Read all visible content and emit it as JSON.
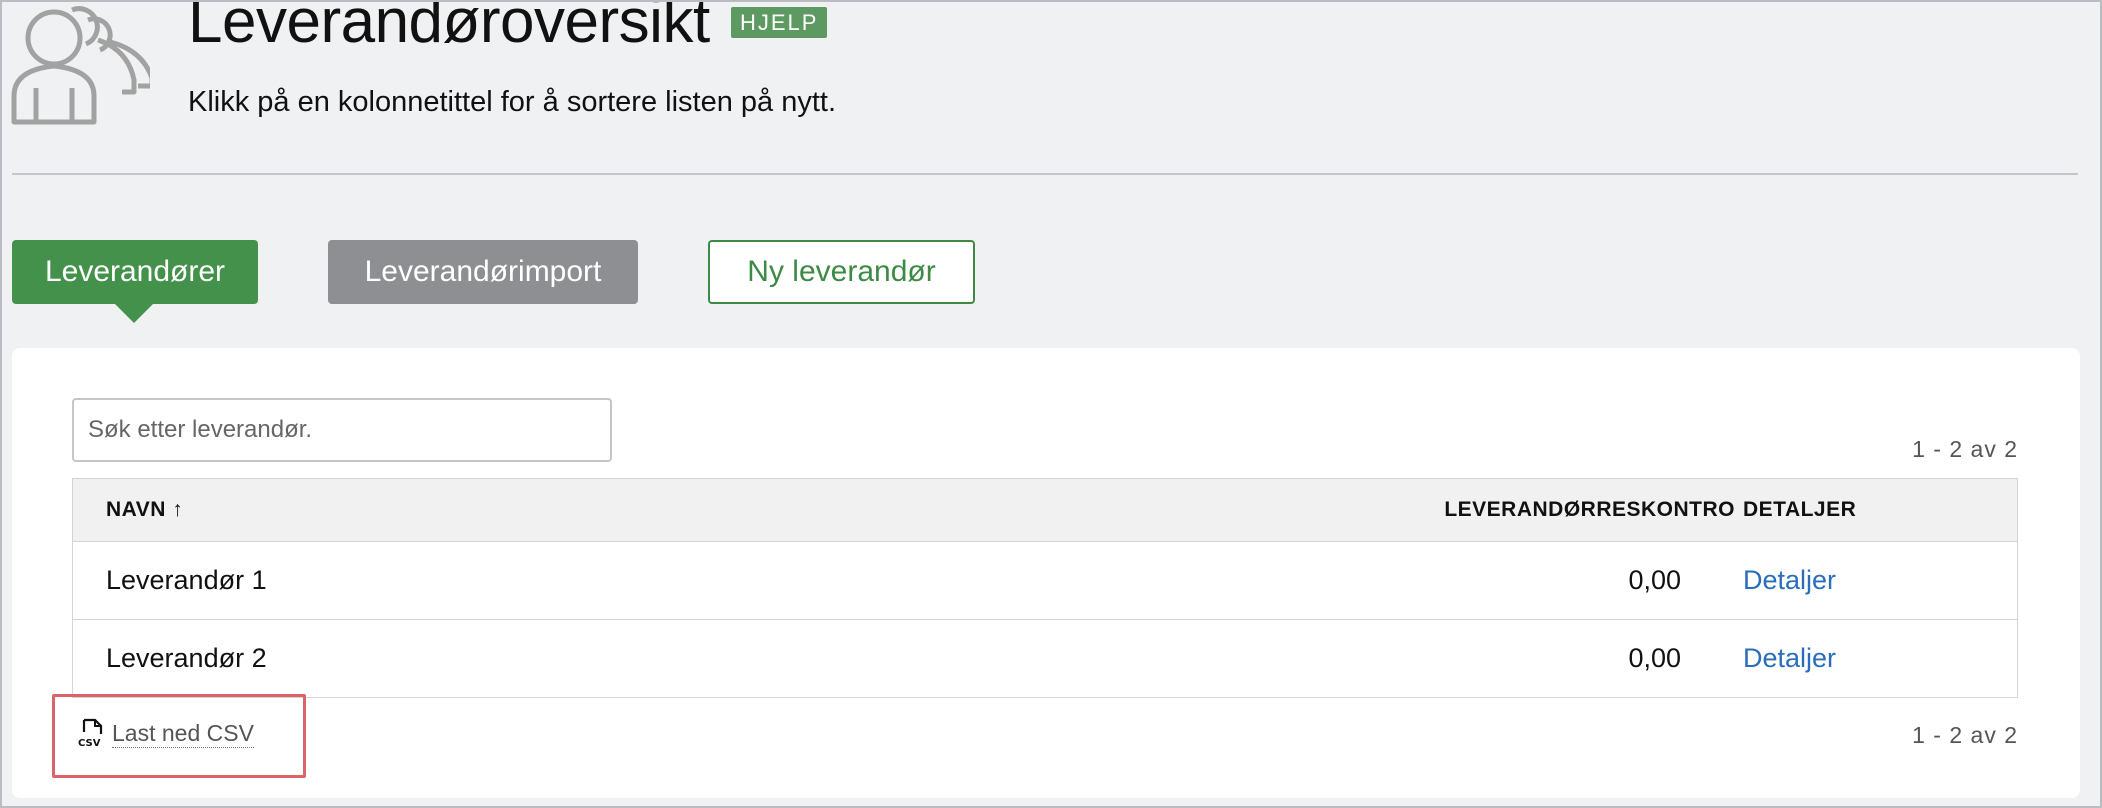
{
  "header": {
    "title": "Leverandøroversikt",
    "help_label": "HJELP",
    "subtitle": "Klikk på en kolonnetittel for å sortere listen på nytt."
  },
  "tabs": {
    "active_label": "Leverandører",
    "import_label": "Leverandørimport",
    "new_label": "Ny leverandør"
  },
  "search": {
    "placeholder": "Søk etter leverandør."
  },
  "pagination": {
    "top": "1 - 2 av 2",
    "bottom": "1 - 2 av 2"
  },
  "table": {
    "columns": {
      "name": "NAVN ↑",
      "ledger": "LEVERANDØRRESKONTRO",
      "details": "DETALJER"
    },
    "rows": [
      {
        "name": "Leverandør 1",
        "ledger": "0,00",
        "details": "Detaljer"
      },
      {
        "name": "Leverandør 2",
        "ledger": "0,00",
        "details": "Detaljer"
      }
    ]
  },
  "csv": {
    "icon": "csv-file-icon",
    "label": "Last ned CSV"
  },
  "colors": {
    "primary_green": "#43914a",
    "link_blue": "#2a6ebb",
    "highlight_red": "#d9646a"
  }
}
